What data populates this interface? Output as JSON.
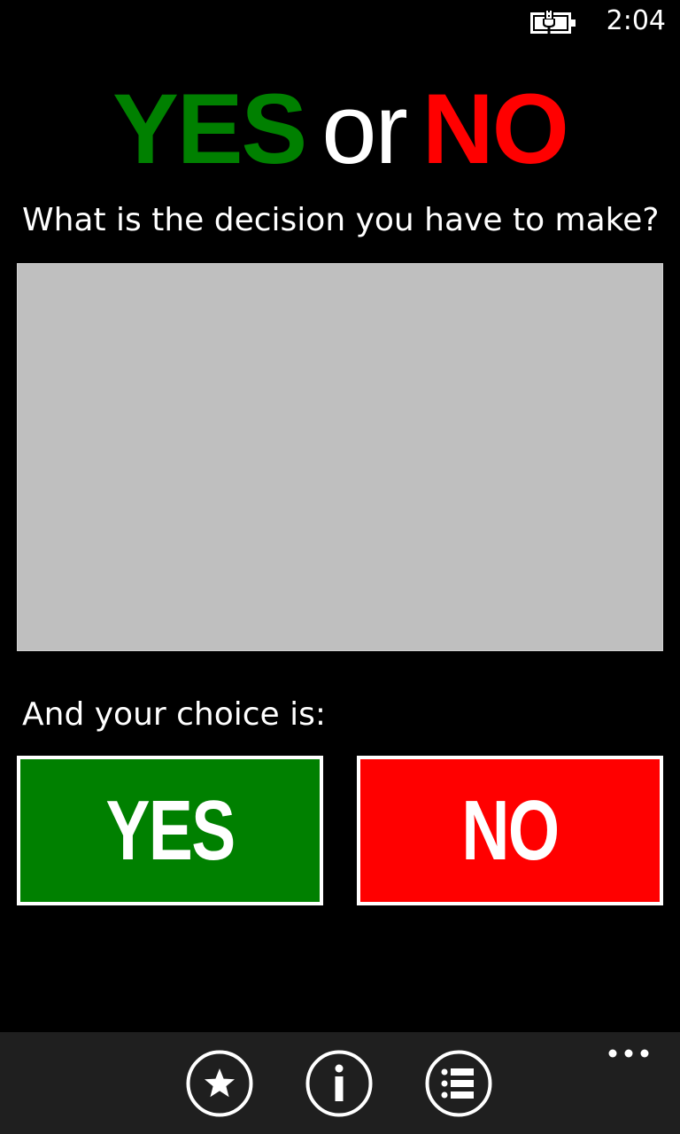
{
  "status_bar": {
    "time": "2:04",
    "battery_icon": "battery-charging-icon"
  },
  "title": {
    "yes": "YES",
    "or": "or",
    "no": "NO"
  },
  "question": {
    "label": "What is the decision you have to make?",
    "input_value": "",
    "input_placeholder": ""
  },
  "choice": {
    "label": "And your choice is:",
    "yes_label": "YES",
    "no_label": "NO"
  },
  "app_bar": {
    "buttons": [
      {
        "icon": "star-icon"
      },
      {
        "icon": "info-icon"
      },
      {
        "icon": "list-icon"
      }
    ],
    "more_icon": "more-icon"
  },
  "colors": {
    "yes": "#008000",
    "no": "#ff0000",
    "background": "#000000",
    "input_background": "#bfbfbf",
    "app_bar": "#1f1f1f"
  }
}
